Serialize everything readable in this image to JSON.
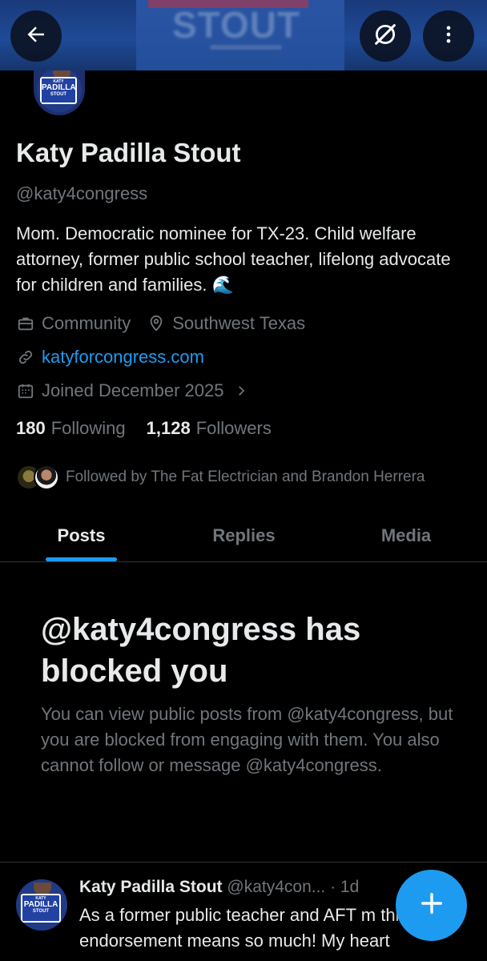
{
  "banner": {
    "text": "STOUT"
  },
  "avatar": {
    "sign_top": "KATY",
    "sign_mid": "PADILLA",
    "sign_bottom": "STOUT"
  },
  "profile": {
    "name": "Katy Padilla Stout",
    "handle": "@katy4congress",
    "bio": "Mom. Democratic nominee for TX-23. Child welfare attorney, former public school teacher, lifelong advocate for children and families. 🌊",
    "category": "Community",
    "location": "Southwest Texas",
    "website": "katyforcongress.com",
    "joined": "Joined December 2025",
    "following_count": "180",
    "following_label": "Following",
    "followers_count": "1,128",
    "followers_label": "Followers",
    "followed_by": "Followed by The Fat Electrician and Brandon Herrera"
  },
  "tabs": [
    {
      "label": "Posts",
      "active": true
    },
    {
      "label": "Replies",
      "active": false
    },
    {
      "label": "Media",
      "active": false
    }
  ],
  "blocked": {
    "title": "@katy4congress has blocked you",
    "description": "You can view public posts from @katy4congress, but you are blocked from engaging with them. You also cannot follow or message @katy4congress."
  },
  "post": {
    "author": "Katy Padilla Stout",
    "handle": "@katy4con...",
    "time": "· 1d",
    "text": "As a former public teacher and AFT m this endorsement means so much! My heart"
  },
  "icons": {
    "back": "arrow-left-icon",
    "grok": "grok-icon",
    "more": "more-vertical-icon",
    "category": "briefcase-icon",
    "location": "location-pin-icon",
    "link": "link-icon",
    "calendar": "calendar-icon",
    "compose": "plus-icon"
  },
  "colors": {
    "accent": "#1d9bf0",
    "muted": "#71767b",
    "text": "#e7e9ea",
    "background": "#000000"
  }
}
